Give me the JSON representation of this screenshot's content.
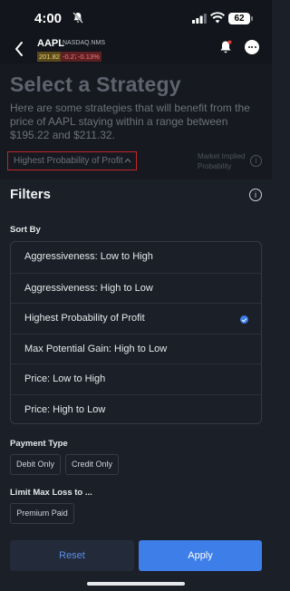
{
  "status": {
    "time": "4:00",
    "battery": "62"
  },
  "header": {
    "ticker": "AAPL",
    "exchange": "NASDAQ.NMS",
    "last": "201.82",
    "change": "-0.27",
    "change_pct": "-0.13%"
  },
  "page": {
    "title": "Select a Strategy",
    "description": "Here are some strategies that will benefit from the price of AAPL staying within a range between $195.22 and $211.32.",
    "sort_trigger_label": "Highest Probability of Profit",
    "implied_label_line1": "Market Implied",
    "implied_label_line2": "Probability"
  },
  "filters": {
    "title": "Filters",
    "sort_by_label": "Sort By",
    "sort_options": [
      {
        "label": "Aggressiveness: Low to High",
        "selected": false
      },
      {
        "label": "Aggressiveness: High to Low",
        "selected": false
      },
      {
        "label": "Highest Probability of Profit",
        "selected": true
      },
      {
        "label": "Max Potential Gain: High to Low",
        "selected": false
      },
      {
        "label": "Price: Low to High",
        "selected": false
      },
      {
        "label": "Price: High to Low",
        "selected": false
      }
    ],
    "payment_type_label": "Payment Type",
    "payment_types": [
      "Debit Only",
      "Credit Only"
    ],
    "limit_loss_label": "Limit Max Loss to ...",
    "limit_loss_options": [
      "Premium Paid"
    ],
    "reset_label": "Reset",
    "apply_label": "Apply"
  },
  "colors": {
    "accent": "#3d7ee8",
    "highlight_border": "#c1272d",
    "negative": "#ff7a7a"
  },
  "icons": {
    "back": "chevron-left-icon",
    "alert": "bell-icon",
    "more": "ellipsis-icon",
    "info": "info-icon",
    "selected": "checkmark-circle-icon"
  }
}
